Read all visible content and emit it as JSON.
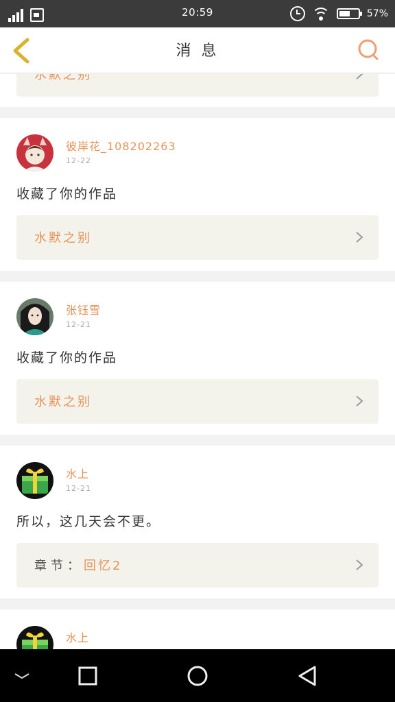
{
  "status_bar": {
    "time": "20:59",
    "battery_percent": "57",
    "battery_level": 0.57
  },
  "header": {
    "title": "消 息"
  },
  "partial_card": {
    "work_title": "水默之别"
  },
  "messages": [
    {
      "username": "彼岸花_108202263",
      "time": "12-22",
      "text": "收藏了你的作品",
      "work_prefix": "",
      "work_title": "水默之别",
      "avatar_colors": [
        "#c8323c",
        "#f5e6da"
      ]
    },
    {
      "username": "张钰雪",
      "time": "12-21",
      "text": "收藏了你的作品",
      "work_prefix": "",
      "work_title": "水默之别",
      "avatar_colors": [
        "#2a9a8a",
        "#1a1a1a"
      ]
    },
    {
      "username": "水上",
      "time": "12-21",
      "text": "所以，这几天会不更。",
      "work_prefix": "章节：",
      "work_title": "回忆2",
      "avatar_colors": [
        "#3aa84a",
        "#f2d33a"
      ]
    },
    {
      "username": "水上",
      "time": "",
      "text": "",
      "work_prefix": "",
      "work_title": "",
      "avatar_colors": [
        "#3aa84a",
        "#f2d33a"
      ]
    }
  ],
  "colors": {
    "accent": "#e8935a",
    "back_arrow": "#d9b230",
    "background": "#f2f2f2",
    "work_box": "#f3f3ec"
  }
}
